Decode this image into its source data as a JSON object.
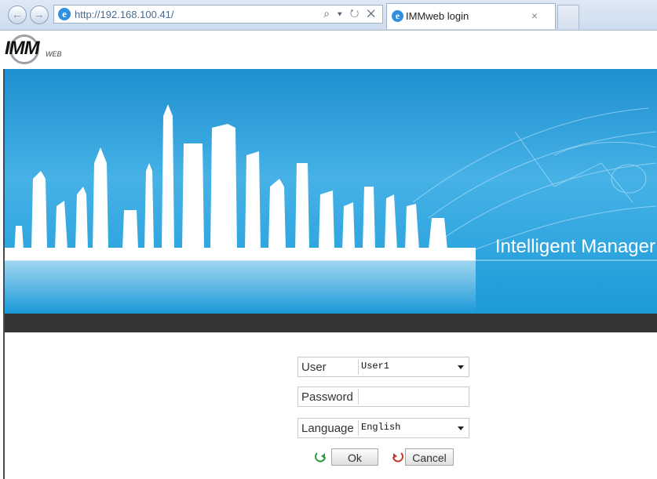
{
  "browser": {
    "back_glyph": "←",
    "forward_glyph": "→",
    "address": "http://192.168.100.41/",
    "address_tools": "⌕ ▾ ↻ ✕",
    "ie_glyph": "e",
    "tab_title": "IMMweb login",
    "tab_close": "×"
  },
  "logo": {
    "main": "IMM",
    "sub": "WEB"
  },
  "banner": {
    "tagline": "Intelligent Manager"
  },
  "form": {
    "user_label": "User",
    "user_value": "User1",
    "password_label": "Password",
    "password_value": "",
    "language_label": "Language",
    "language_value": "English",
    "ok_label": "Ok",
    "cancel_label": "Cancel"
  },
  "colors": {
    "banner_blue": "#1e8fcf",
    "dark_bar": "#323436",
    "ok_icon": "#2a9a3a",
    "cancel_icon": "#c0392b"
  }
}
